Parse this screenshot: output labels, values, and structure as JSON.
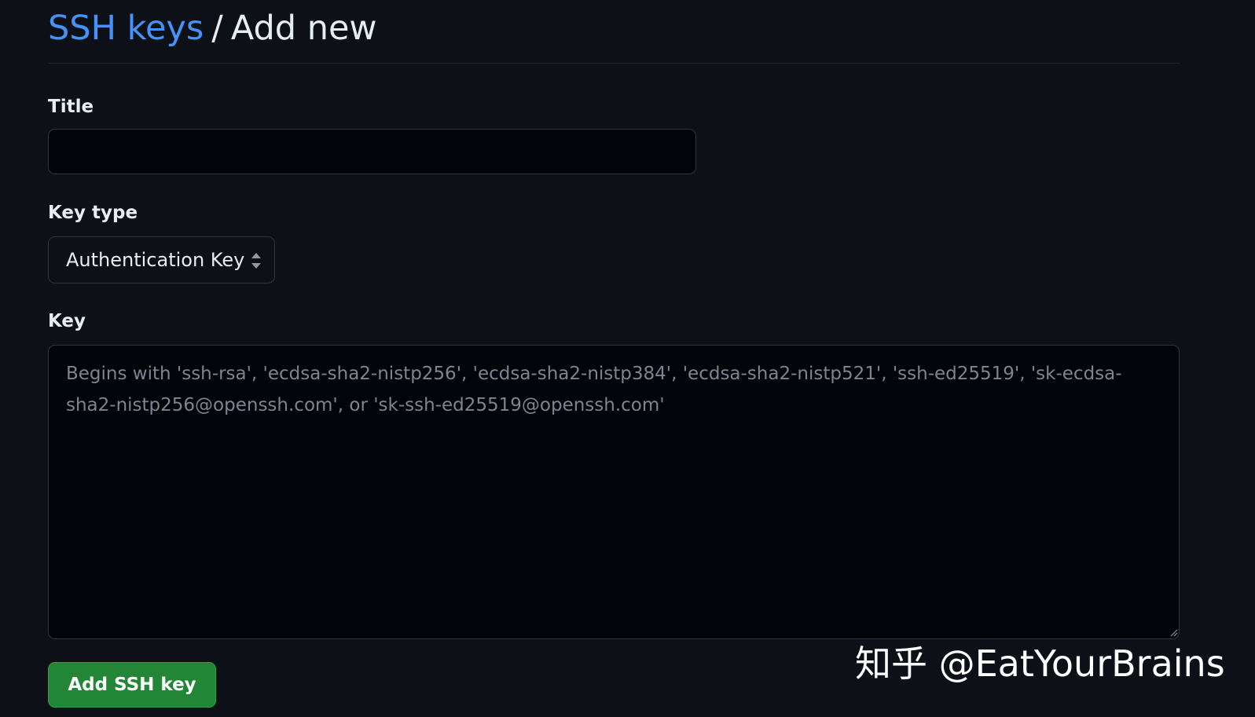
{
  "breadcrumb": {
    "link_label": "SSH keys",
    "separator": "/",
    "current": "Add new"
  },
  "form": {
    "title_label": "Title",
    "title_value": "",
    "key_type_label": "Key type",
    "key_type_selected": "Authentication Key",
    "key_label": "Key",
    "key_placeholder": "Begins with 'ssh-rsa', 'ecdsa-sha2-nistp256', 'ecdsa-sha2-nistp384', 'ecdsa-sha2-nistp521', 'ssh-ed25519', 'sk-ecdsa-sha2-nistp256@openssh.com', or 'sk-ssh-ed25519@openssh.com'",
    "submit_label": "Add SSH key"
  },
  "watermark": {
    "text": "知乎 @EatYourBrains"
  },
  "colors": {
    "background": "#0d1117",
    "link": "#4493f8",
    "primary_button": "#238636",
    "input_background": "#010409",
    "border": "#30363d"
  }
}
